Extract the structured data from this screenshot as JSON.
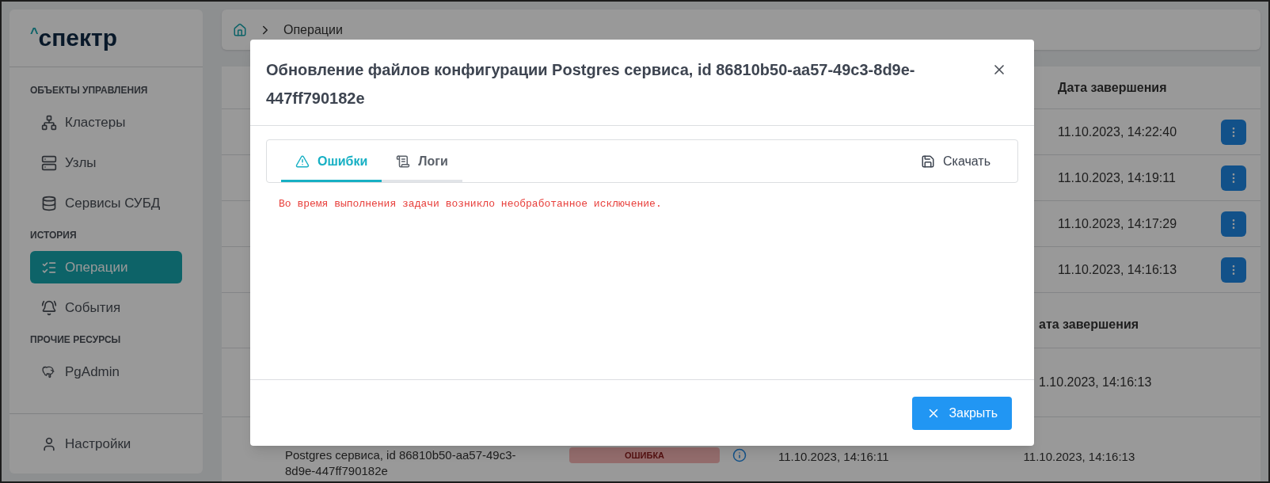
{
  "sidebar": {
    "logo": {
      "mark": "^",
      "text": "спектр"
    },
    "sections": [
      {
        "title": "ОБЪЕКТЫ УПРАВЛЕНИЯ",
        "items": [
          {
            "label": "Кластеры",
            "selected": false
          },
          {
            "label": "Узлы",
            "selected": false
          },
          {
            "label": "Сервисы СУБД",
            "selected": false
          }
        ]
      },
      {
        "title": "ИСТОРИЯ",
        "items": [
          {
            "label": "Операции",
            "selected": true
          },
          {
            "label": "События",
            "selected": false
          }
        ]
      },
      {
        "title": "ПРОЧИЕ РЕСУРСЫ",
        "items": [
          {
            "label": "PgAdmin",
            "selected": false
          }
        ]
      }
    ],
    "footer_item": {
      "label": "Настройки"
    }
  },
  "breadcrumb": [
    "Операции"
  ],
  "operations_table": {
    "column_header": "Дата завершения",
    "rows": [
      {
        "end_date": "11.10.2023, 14:22:40"
      },
      {
        "end_date": "11.10.2023, 14:19:11"
      },
      {
        "end_date": "11.10.2023, 14:17:29"
      },
      {
        "end_date": "11.10.2023, 14:16:13"
      }
    ]
  },
  "nested_table": {
    "column_header": "ата завершения",
    "rows": [
      {
        "end_date": "1.10.2023, 14:16:13"
      },
      {
        "name": "Postgres сервиса, id 86810b50-aa57-49c3-8d9e-447ff790182e",
        "status": "ОШИБКА",
        "start_date": "11.10.2023, 14:16:11",
        "end_date": "11.10.2023, 14:16:13"
      }
    ]
  },
  "modal": {
    "title": "Обновление файлов конфигурации Postgres сервиса, id 86810b50-aa57-49c3-8d9e-447ff790182e",
    "tabs": [
      {
        "label": "Ошибки",
        "selected": true
      },
      {
        "label": "Логи",
        "selected": false
      }
    ],
    "download_button": "Скачать",
    "error_text": "Во время выполнения задачи возникло необработанное исключение.",
    "close_button": "Закрыть"
  }
}
